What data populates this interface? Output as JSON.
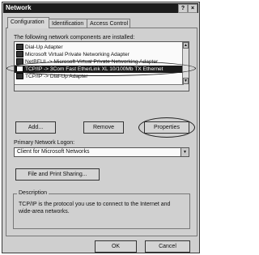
{
  "window": {
    "title": "Network",
    "help_btn": "?",
    "close_btn": "×"
  },
  "tabs": [
    {
      "label": "Configuration"
    },
    {
      "label": "Identification"
    },
    {
      "label": "Access Control"
    }
  ],
  "components_label": "The following network components are installed:",
  "components": [
    {
      "label": "Dial-Up Adapter"
    },
    {
      "label": "Microsoft Virtual Private Networking Adapter"
    },
    {
      "label": "NetBEUI -> Microsoft Virtual Private Networking Adapter"
    },
    {
      "label": "TCP/IP -> 3Com Fast EtherLink XL 10/100Mb TX Ethernet"
    },
    {
      "label": "TCP/IP -> Dial-Up Adapter"
    }
  ],
  "buttons": {
    "add": "Add...",
    "remove": "Remove",
    "properties": "Properties"
  },
  "logon": {
    "label": "Primary Network Logon:",
    "value": "Client for Microsoft Networks"
  },
  "file_print_button": "File and Print Sharing...",
  "description": {
    "title": "Description",
    "text": "TCP/IP is the protocol you use to connect to the Internet and wide-area networks."
  },
  "footer": {
    "ok": "OK",
    "cancel": "Cancel"
  }
}
